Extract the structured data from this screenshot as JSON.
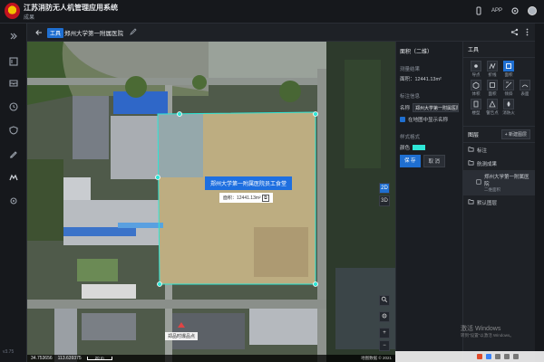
{
  "header": {
    "title": "江苏消防无人机管理应用系统",
    "subtitle": "成果",
    "app_label": "APP"
  },
  "sidebar": {
    "items": [
      {
        "icon": "expand-icon"
      },
      {
        "icon": "document-icon"
      },
      {
        "icon": "inbox-icon"
      },
      {
        "icon": "history-icon"
      },
      {
        "icon": "shield-icon"
      },
      {
        "icon": "pen-icon"
      },
      {
        "icon": "drone-icon"
      },
      {
        "icon": "settings-icon"
      }
    ],
    "version": "v3.75"
  },
  "subbar": {
    "badge": "工具",
    "project_name": "郑州大学第一附属医院"
  },
  "map": {
    "polygon_label": "郑州大学第一附属医院员工食堂",
    "area_label": "面积：12441.13m²",
    "location_label": "郑品时爆品点",
    "btn_2d": "2D",
    "btn_3d": "3D",
    "coord_lat": "34.753656",
    "coord_lng": "113.639375",
    "scale_label": "20 m",
    "attribution": "地图数据 © 2021"
  },
  "properties": {
    "title": "面积（二维）",
    "measure_section": "测量结果",
    "area_value": "面积：12441.13m²",
    "label_section": "标注信息",
    "name_label": "名称",
    "name_value": "郑州大学第一附属医院员工",
    "show_in_map_label": "在地图中显示名称",
    "style_section": "样式格式",
    "color_label": "颜色",
    "save_label": "保 存",
    "cancel_label": "取 消",
    "color_value": "#2ee6d6"
  },
  "tools": {
    "title": "工具",
    "items": [
      {
        "label": "导点",
        "active": false,
        "icon": "point-icon"
      },
      {
        "label": "折线",
        "active": false,
        "icon": "polyline-icon"
      },
      {
        "label": "面积",
        "active": true,
        "icon": "area-icon"
      },
      {
        "label": "",
        "active": false,
        "icon": "blank"
      },
      {
        "label": "体积",
        "active": false,
        "icon": "volume-icon"
      },
      {
        "label": "面积",
        "active": false,
        "icon": "area2-icon"
      },
      {
        "label": "倾斜",
        "active": false,
        "icon": "tilt-icon"
      },
      {
        "label": "表面",
        "active": false,
        "icon": "surface-icon"
      },
      {
        "label": "楼型",
        "active": false,
        "icon": "building-icon"
      },
      {
        "label": "警告点",
        "active": false,
        "icon": "warning-icon"
      },
      {
        "label": "消防火",
        "active": false,
        "icon": "fire-icon"
      }
    ]
  },
  "layers": {
    "title": "图层",
    "new_button": "+ 新建图层",
    "items": [
      {
        "name": "标注",
        "level": 0
      },
      {
        "name": "航测成果",
        "level": 0
      },
      {
        "name": "郑州大学第一附属医院",
        "meta": "二维面积",
        "level": 1
      },
      {
        "name": "默认图层",
        "level": 0
      }
    ]
  },
  "windows": {
    "activate": "激活 Windows",
    "activate_sub": "转到\"设置\"以激活 Windows。"
  }
}
